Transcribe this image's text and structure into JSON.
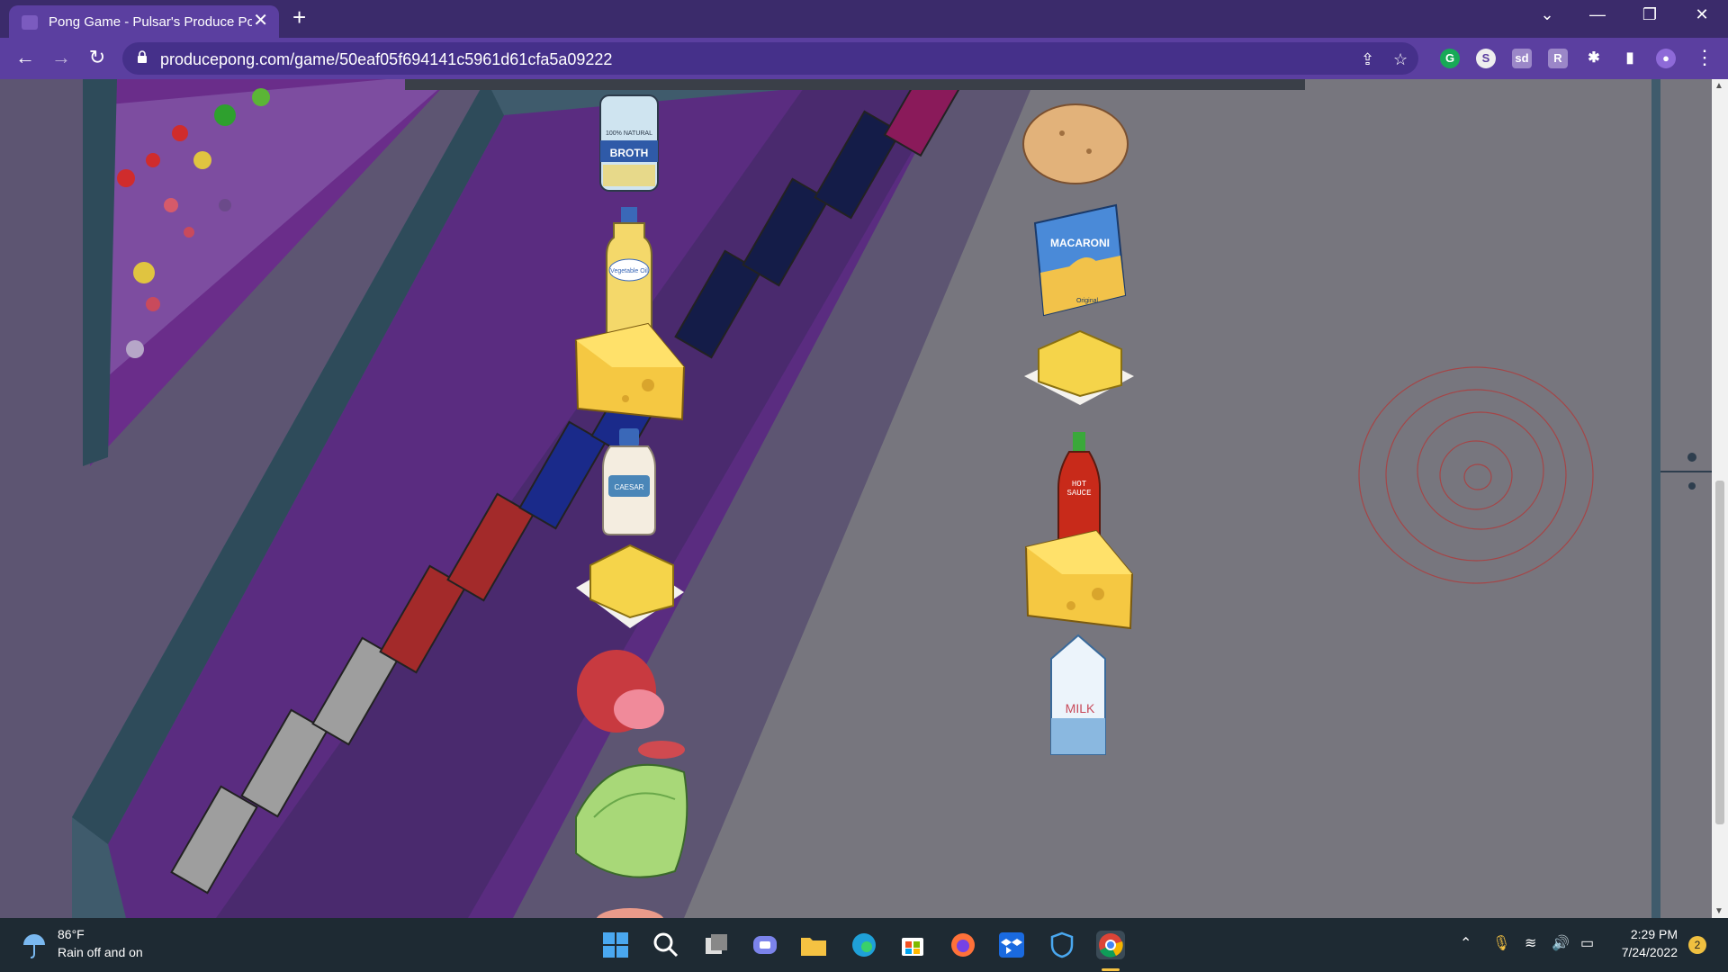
{
  "browser": {
    "tab_title": "Pong Game - Pulsar's Produce Pong",
    "tab_close": "✕",
    "new_tab": "+",
    "url": "producepong.com/game/50eaf05f694141c5961d61cfa5a09222",
    "window_controls": {
      "dropdown": "⌄",
      "minimize": "—",
      "restore": "❐",
      "close": "✕"
    },
    "nav": {
      "back": "←",
      "forward": "→",
      "reload": "↻",
      "menu": "⋮"
    }
  },
  "game": {
    "left_column_items": [
      "broth can",
      "vegetable oil bottle",
      "cheese wedge",
      "caesar dressing bottle",
      "butter block",
      "ham",
      "lettuce",
      "shrimp"
    ],
    "right_column_items": [
      "potato",
      "macaroni box",
      "butter block",
      "hot sauce bottle",
      "cheese wedge",
      "milk carton"
    ],
    "labels": {
      "broth_top": "100% NATURAL",
      "broth": "BROTH",
      "oil": "Vegetable Oil",
      "caesar": "CAESAR",
      "macaroni": "MACARONI",
      "macaroni_sub": "Original",
      "hot_sauce_1": "HOT",
      "hot_sauce_2": "SAUCE",
      "milk": "MILK"
    }
  },
  "taskbar": {
    "weather_temp": "86°F",
    "weather_desc": "Rain off and on",
    "time": "2:29 PM",
    "date": "7/24/2022",
    "notification_count": "2"
  }
}
